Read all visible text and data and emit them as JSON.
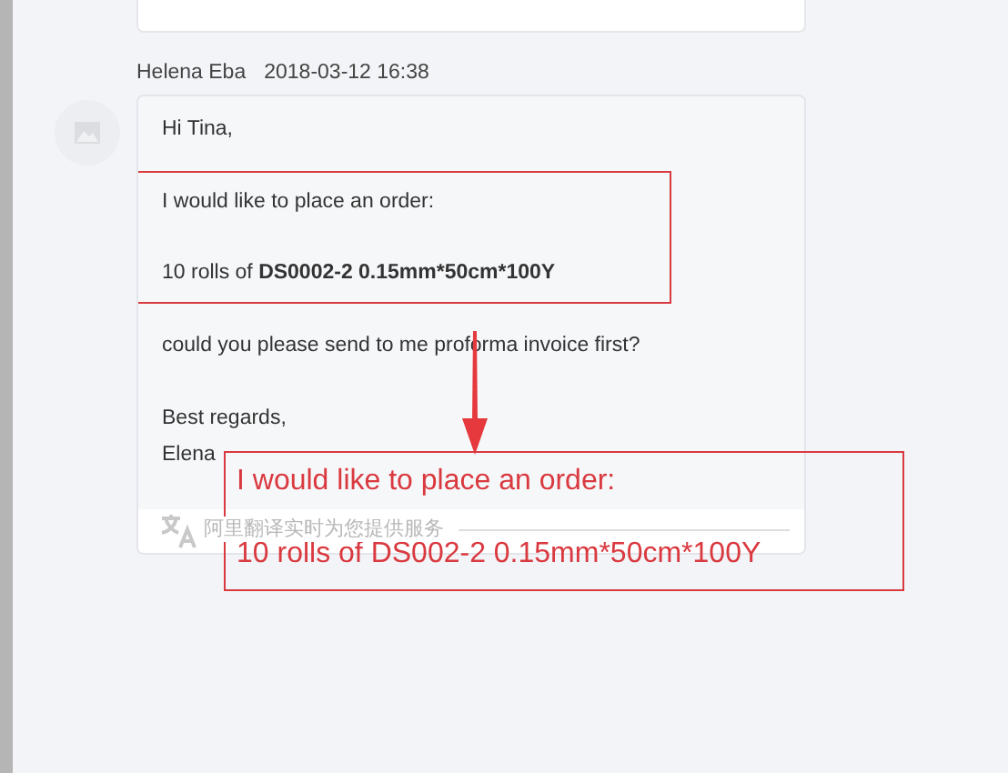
{
  "message": {
    "author": "Helena Eba",
    "time": "2018-03-12 16:38",
    "blocks": [
      {
        "highlighted": false,
        "lines": [
          {
            "text": "Hi Tina,"
          }
        ]
      },
      {
        "highlighted": true,
        "lines": [
          {
            "text": "I would like to place an order:"
          },
          {
            "emphasis": "DS0002-2 0.15mm*50cm*100Y",
            "lead": "10 rolls of "
          }
        ]
      },
      {
        "highlighted": false,
        "lines": [
          {
            "text": "could you please send to me proforma invoice first?"
          }
        ]
      },
      {
        "highlighted": false,
        "lines": [
          {
            "text": "Best regards,"
          },
          {
            "text": "Elena"
          }
        ]
      }
    ],
    "translation_note": "阿里翻译实时为您提供服务"
  },
  "annotation": {
    "lines": [
      "I would like to place an order:",
      "10 rolls of DS002-2 0.15mm*50cm*100Y"
    ]
  }
}
